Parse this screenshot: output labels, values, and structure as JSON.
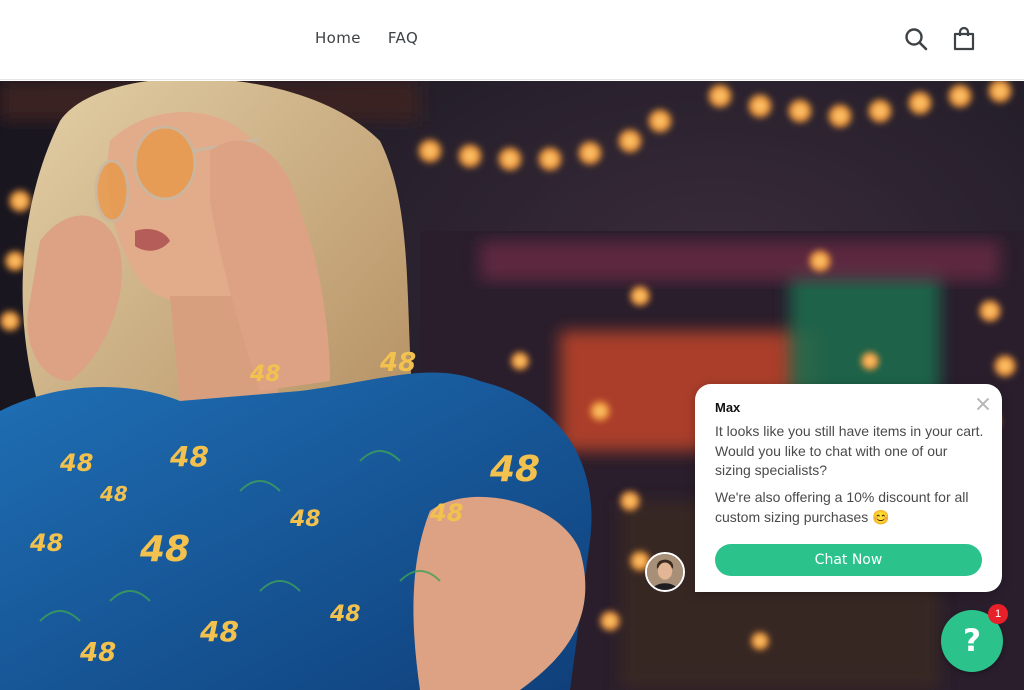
{
  "header": {
    "nav": [
      {
        "label": "Home"
      },
      {
        "label": "FAQ"
      }
    ],
    "icons": {
      "search": "search-icon",
      "cart": "cart-icon"
    }
  },
  "hero": {
    "image": "woman in sunglasses and blue #48 racing shirt in front of carnival lights"
  },
  "chat": {
    "agent_name": "Max",
    "message_1": "It looks like you still have items in your cart. Would you like to chat with one of our sizing specialists?",
    "message_2": "We're also offering a 10% discount for all custom sizing purchases 😊",
    "cta_label": "Chat Now"
  },
  "help": {
    "label": "?",
    "badge_count": "1"
  },
  "colors": {
    "accent": "#2bc38b",
    "badge": "#e8202a",
    "text": "#3d4246"
  }
}
